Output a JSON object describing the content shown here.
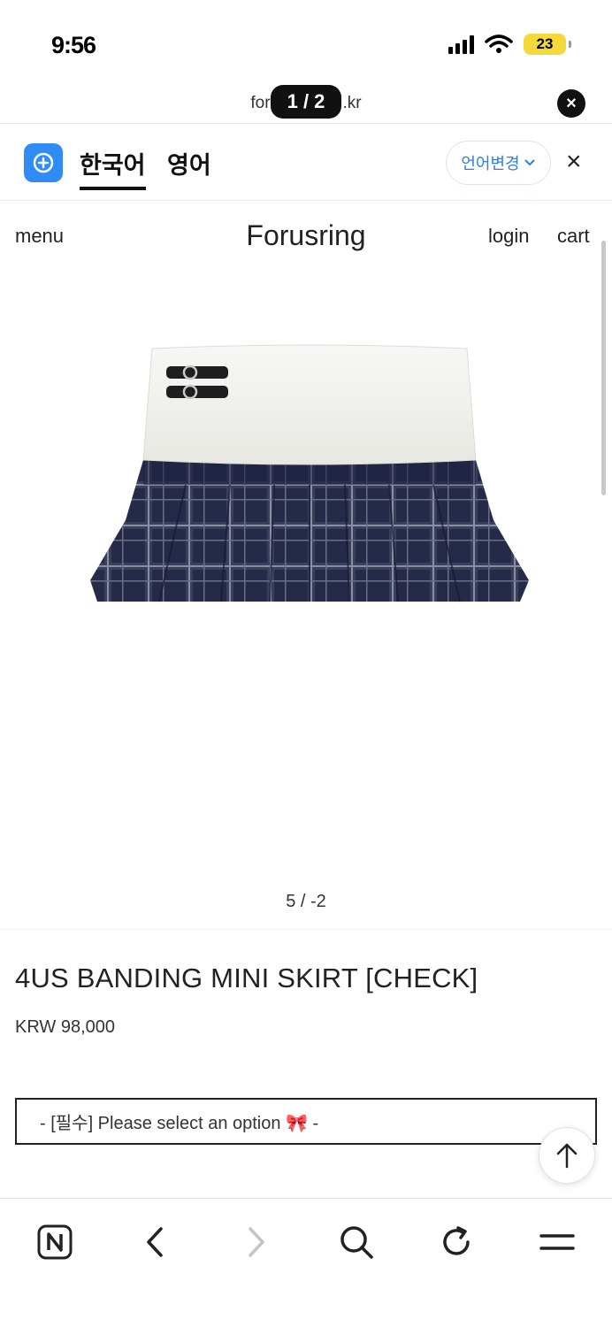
{
  "status_bar": {
    "time": "9:56",
    "battery": "23"
  },
  "url_bar": {
    "url_left": "for",
    "url_right": ".kr",
    "page_indicator": "1 / 2",
    "close_symbol": "×"
  },
  "translate_bar": {
    "tabs": [
      {
        "label": "한국어",
        "active": true
      },
      {
        "label": "영어",
        "active": false
      }
    ],
    "change_language": "언어변경",
    "close_symbol": "×"
  },
  "site_header": {
    "menu": "menu",
    "brand": "Forusring",
    "login": "login",
    "cart": "cart"
  },
  "gallery": {
    "counter": "5 / -2"
  },
  "product": {
    "title": "4US BANDING MINI SKIRT [CHECK]",
    "price": "KRW 98,000",
    "option_placeholder": "- [필수] Please select an option 🎀 -"
  },
  "toolbar": {
    "icons": [
      "naver-home-icon",
      "back-icon",
      "forward-icon",
      "search-icon",
      "refresh-icon",
      "menu-icon"
    ]
  },
  "colors": {
    "accent_blue": "#2f7ee8",
    "battery_yellow": "#f3d93a",
    "skirt_navy": "#252a48",
    "waistband_cream": "#f2f2ef"
  }
}
